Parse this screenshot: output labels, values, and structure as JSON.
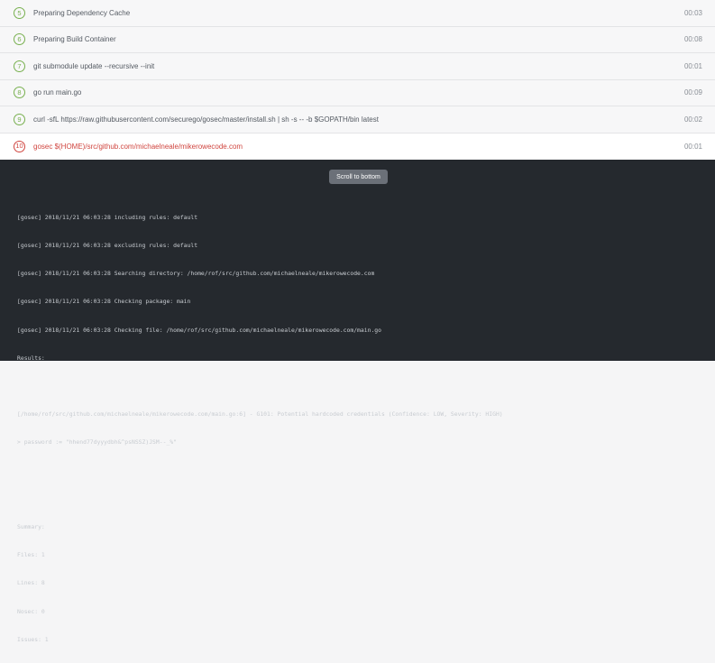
{
  "steps": [
    {
      "number": "5",
      "name": "Preparing Dependency Cache",
      "duration": "00:03",
      "status": "success"
    },
    {
      "number": "6",
      "name": "Preparing Build Container",
      "duration": "00:08",
      "status": "success"
    },
    {
      "number": "7",
      "name": "git submodule update --recursive --init",
      "duration": "00:01",
      "status": "success"
    },
    {
      "number": "8",
      "name": "go run main.go",
      "duration": "00:09",
      "status": "success"
    },
    {
      "number": "9",
      "name": "curl -sfL https://raw.githubusercontent.com/securego/gosec/master/install.sh | sh -s -- -b $GOPATH/bin latest",
      "duration": "00:02",
      "status": "success"
    },
    {
      "number": "10",
      "name": "gosec $(HOME)/src/github.com/michaelneale/mikerowecode.com",
      "duration": "00:01",
      "status": "failed"
    }
  ],
  "log": {
    "scroll_button_label": "Scroll to bottom",
    "lines": [
      "[gosec] 2018/11/21 06:03:28 including rules: default",
      "[gosec] 2018/11/21 06:03:28 excluding rules: default",
      "[gosec] 2018/11/21 06:03:28 Searching directory: /home/rof/src/github.com/michaelneale/mikerowecode.com",
      "[gosec] 2018/11/21 06:03:28 Checking package: main",
      "[gosec] 2018/11/21 06:03:28 Checking file: /home/rof/src/github.com/michaelneale/mikerowecode.com/main.go",
      "Results:",
      "",
      "[/home/rof/src/github.com/michaelneale/mikerowecode.com/main.go:6] - G101: Potential hardcoded credentials (Confidence: LOW, Severity: HIGH)",
      "> password := \"hhend77dyyydbh&^psNSSZ)JSM--_%\"",
      "",
      "",
      "Summary:",
      "Files: 1",
      "Lines: 8",
      "Nosec: 0",
      "Issues: 1"
    ]
  },
  "colors": {
    "success": "#78b04f",
    "failed": "#d0453f",
    "log_background": "#25292e",
    "row_background": "#f7f7f8"
  }
}
